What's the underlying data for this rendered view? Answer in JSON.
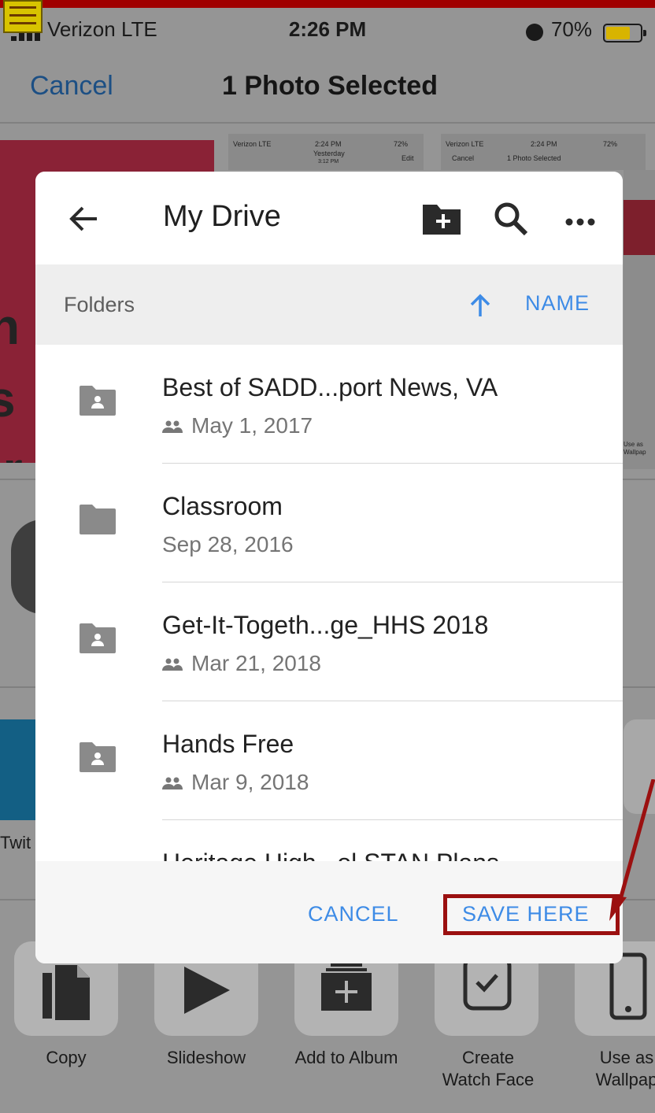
{
  "status_bar": {
    "carrier": "Verizon  LTE",
    "time": "2:26 PM",
    "battery": "70%"
  },
  "nav": {
    "cancel_label": "Cancel",
    "title": "1 Photo Selected"
  },
  "background": {
    "photo_letters": [
      "n",
      "s",
      "ir",
      "rr"
    ],
    "thumb_left": {
      "carrier": "Verizon  LTE",
      "time": "2:24 PM",
      "battery": "72%",
      "title": "Yesterday",
      "subtitle": "3:12 PM",
      "action": "Edit"
    },
    "thumb_right": {
      "carrier": "Verizon  LTE",
      "time": "2:24 PM",
      "battery": "72%",
      "cancel": "Cancel",
      "title": "1 Photo Selected"
    },
    "partial_labels": {
      "twitter": "Twit",
      "side_use_as": "Use as",
      "side_wallpaper": "Wallpap"
    }
  },
  "actions": [
    {
      "label": "Copy",
      "icon": "copy-icon"
    },
    {
      "label": "Slideshow",
      "icon": "play-icon"
    },
    {
      "label": "Add to Album",
      "icon": "add-album-icon"
    },
    {
      "label": "Create\nWatch Face",
      "icon": "watch-icon"
    },
    {
      "label": "Use as\nWallpap",
      "icon": "phone-icon"
    }
  ],
  "dialog": {
    "title": "My Drive",
    "header_icons": [
      "back-arrow-icon",
      "new-folder-icon",
      "search-icon",
      "more-icon"
    ],
    "sort_bar": {
      "section_label": "Folders",
      "sort_field": "NAME",
      "sort_direction": "ascending"
    },
    "folders": [
      {
        "name": "Best of SADD...port News, VA",
        "date": "May 1, 2017",
        "shared": true
      },
      {
        "name": "Classroom",
        "date": "Sep 28, 2016",
        "shared": false
      },
      {
        "name": "Get-It-Togeth...ge_HHS 2018",
        "date": "Mar 21, 2018",
        "shared": true
      },
      {
        "name": "Hands Free",
        "date": "Mar 9, 2018",
        "shared": true
      },
      {
        "name": "Heritage High...ol STAN Plans",
        "date": "",
        "shared": false
      }
    ],
    "footer": {
      "cancel_label": "CANCEL",
      "save_label": "SAVE HERE"
    }
  },
  "colors": {
    "accent_blue": "#3d8be6",
    "annotation_red": "#9b1010",
    "folder_gray": "#8a8a8a"
  }
}
